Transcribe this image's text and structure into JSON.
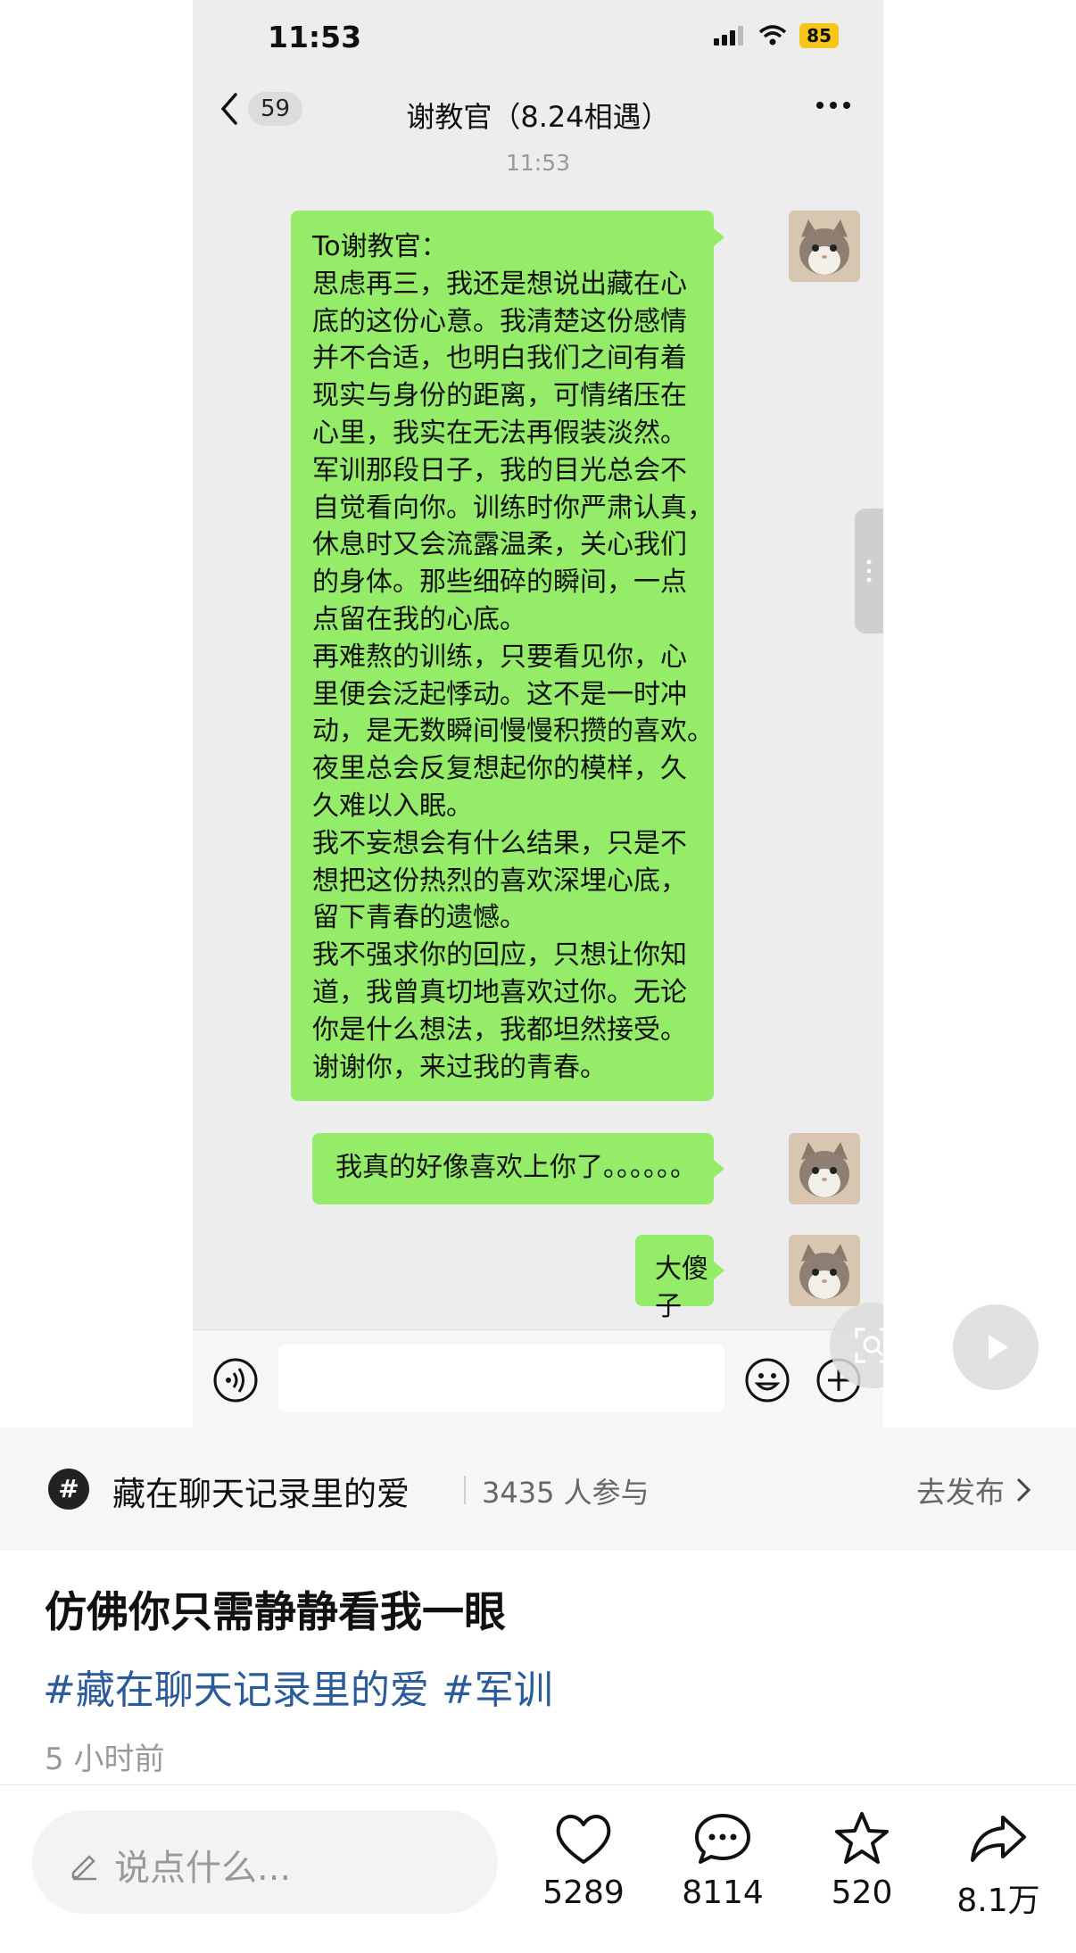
{
  "status": {
    "time": "11:53",
    "battery": "85"
  },
  "chat": {
    "unread": "59",
    "title": "谢教官（8.24相遇）",
    "timestamp": "11:53",
    "messages": [
      {
        "text": "To谢教官：\n思虑再三，我还是想说出藏在心\n底的这份心意。我清楚这份感情\n并不合适，也明白我们之间有着\n现实与身份的距离，可情绪压在\n心里，我实在无法再假装淡然。\n军训那段日子，我的目光总会不\n自觉看向你。训练时你严肃认真，\n休息时又会流露温柔，关心我们\n的身体。那些细碎的瞬间，一点\n点留在我的心底。\n再难熬的训练，只要看见你，心\n里便会泛起悸动。这不是一时冲\n动，是无数瞬间慢慢积攒的喜欢。\n夜里总会反复想起你的模样，久\n久难以入眠。\n我不妄想会有什么结果，只是不\n想把这份热烈的喜欢深埋心底，\n留下青春的遗憾。\n我不强求你的回应，只想让你知\n道，我曾真切地喜欢过你。无论\n你是什么想法，我都坦然接受。\n谢谢你，来过我的青春。"
      },
      {
        "text": "我真的好像喜欢上你了。。。。。。"
      },
      {
        "text": "大傻子"
      }
    ]
  },
  "topic": {
    "name": "藏在聊天记录里的爱",
    "count": "3435 人参与",
    "action": "去发布"
  },
  "post": {
    "title": "仿佛你只需静静看我一眼",
    "tags": "#藏在聊天记录里的爱 #军训",
    "time": "5 小时前"
  },
  "bottom": {
    "comment_placeholder": "说点什么...",
    "likes": "5289",
    "comments": "8114",
    "favorites": "520",
    "shares": "8.1万"
  },
  "colors": {
    "bubble": "#95ec69",
    "tag": "#2b5b9a",
    "battery": "#f5c518"
  }
}
